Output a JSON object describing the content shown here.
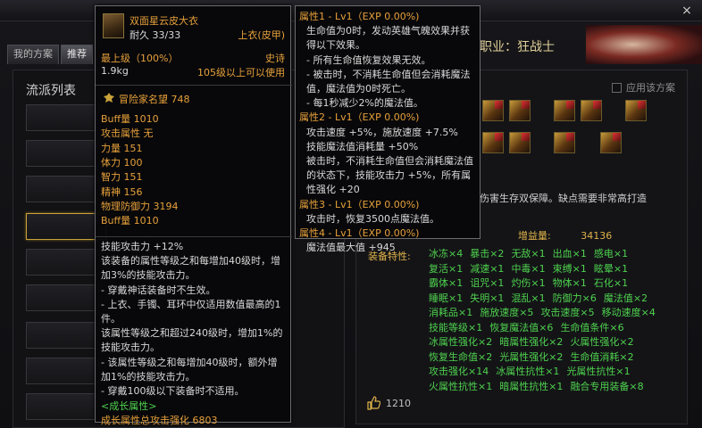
{
  "window": {
    "close_glyph": "×"
  },
  "tabs": [
    {
      "label": "我的方案"
    },
    {
      "label": "推荐"
    }
  ],
  "left_panel": {
    "title": "流派列表"
  },
  "job": {
    "label": "职业：狂战士"
  },
  "apply_scheme": {
    "label": "应用该方案",
    "checked": false
  },
  "description": "伤害生存双保障。缺点需要非常高打造",
  "gain": {
    "label": "增益量:",
    "value": "34136"
  },
  "traits": {
    "title": "装备特性:",
    "rows": [
      [
        "冰冻×4",
        "暴击×2",
        "无敌×1",
        "出血×1",
        "感电×1"
      ],
      [
        "复活×1",
        "减速×1",
        "中毒×1",
        "束缚×1",
        "眩晕×1"
      ],
      [
        "霸体×1",
        "诅咒×1",
        "灼伤×1",
        "物体×1",
        "石化×1"
      ],
      [
        "睡眠×1",
        "失明×1",
        "混乱×1",
        "防御力×6",
        "魔法值×2"
      ],
      [
        "消耗品×1",
        "施放速度×5",
        "攻击速度×5",
        "移动速度×4"
      ],
      [
        "技能等级×1",
        "恢复魔法值×6",
        "生命值条件×6"
      ],
      [
        "冰属性强化×2",
        "暗属性强化×2",
        "火属性强化×2"
      ],
      [
        "恢复生命值×2",
        "光属性强化×2",
        "生命值消耗×2"
      ],
      [
        "攻击强化×14",
        "冰属性抗性×1",
        "光属性抗性×1"
      ],
      [
        "火属性抗性×1",
        "暗属性抗性×1",
        "融合专用装备×8"
      ]
    ]
  },
  "likes": {
    "count": "1210"
  },
  "item_tooltip": {
    "name": "双面星云皮大衣",
    "rarity": "史诗",
    "durability": "耐久 33/33",
    "slot": "上衣(皮甲)",
    "level": "最上级（100%）",
    "weight": "1.9kg",
    "level_req": "105级以上可以使用",
    "fame": "冒险家名望 748",
    "stats": [
      {
        "text": "Buff量 1010",
        "color": "gold"
      },
      {
        "text": "攻击属性 无",
        "color": "gold"
      },
      {
        "text": "力量 151",
        "color": "gold"
      },
      {
        "text": "体力 100",
        "color": "gold"
      },
      {
        "text": "智力 151",
        "color": "gold"
      },
      {
        "text": "精神 156",
        "color": "gold"
      },
      {
        "text": "物理防御力 3194",
        "color": "gold"
      },
      {
        "text": "Buff量 1010",
        "color": "gold"
      }
    ],
    "effect_lines": [
      "技能攻击力 +12%",
      "该装备的属性等级之和每增加40级时，增",
      "加3%的技能攻击力。",
      "- 穿戴神话装备时不生效。",
      "- 上衣、手镯、耳环中仅适用数值最高的1",
      "件。",
      "该属性等级之和超过240级时，增加1%的",
      "技能攻击力。",
      "- 该属性等级之和每增加40级时，额外增",
      "加1%的技能攻击力。",
      "- 穿戴100级以下装备时不适用。"
    ],
    "growth_header": "<成长属性>",
    "growth_total": "成长属性总攻击强化 6803"
  },
  "prop_tooltip": {
    "blocks": [
      {
        "header": "属性1 - Lv1（EXP 0.00%)",
        "lines": [
          "生命值为0时，发动英雄气魄效果并获",
          "得以下效果。",
          "- 所有生命值恢复效果无效。",
          "- 被击时，不消耗生命值但会消耗魔法",
          "值，魔法值为0时死亡。",
          "- 每1秒减少2%的魔法值。"
        ]
      },
      {
        "header": "属性2 - Lv1（EXP 0.00%)",
        "lines": [
          "攻击速度 +5%，施放速度 +7.5%",
          "技能魔法值消耗量 +50%",
          "被击时，不消耗生命值但会消耗魔法值",
          "的状态下，技能攻击力 +5%，所有属",
          "性强化 +20"
        ]
      },
      {
        "header": "属性3 - Lv1（EXP 0.00%)",
        "lines": [
          "攻击时，恢复3500点魔法值。"
        ]
      },
      {
        "header": "属性4 - Lv1（EXP 0.00%)",
        "lines": [
          "魔法值最大值 +945"
        ]
      }
    ]
  },
  "colors": {
    "gold": "#e6a03a",
    "green": "#4ed24e",
    "accent_border": "#c9a23a"
  },
  "icons": [
    "close-icon",
    "item-coat-icon",
    "fame-icon",
    "thumbs-up-icon",
    "equipment-icon"
  ]
}
